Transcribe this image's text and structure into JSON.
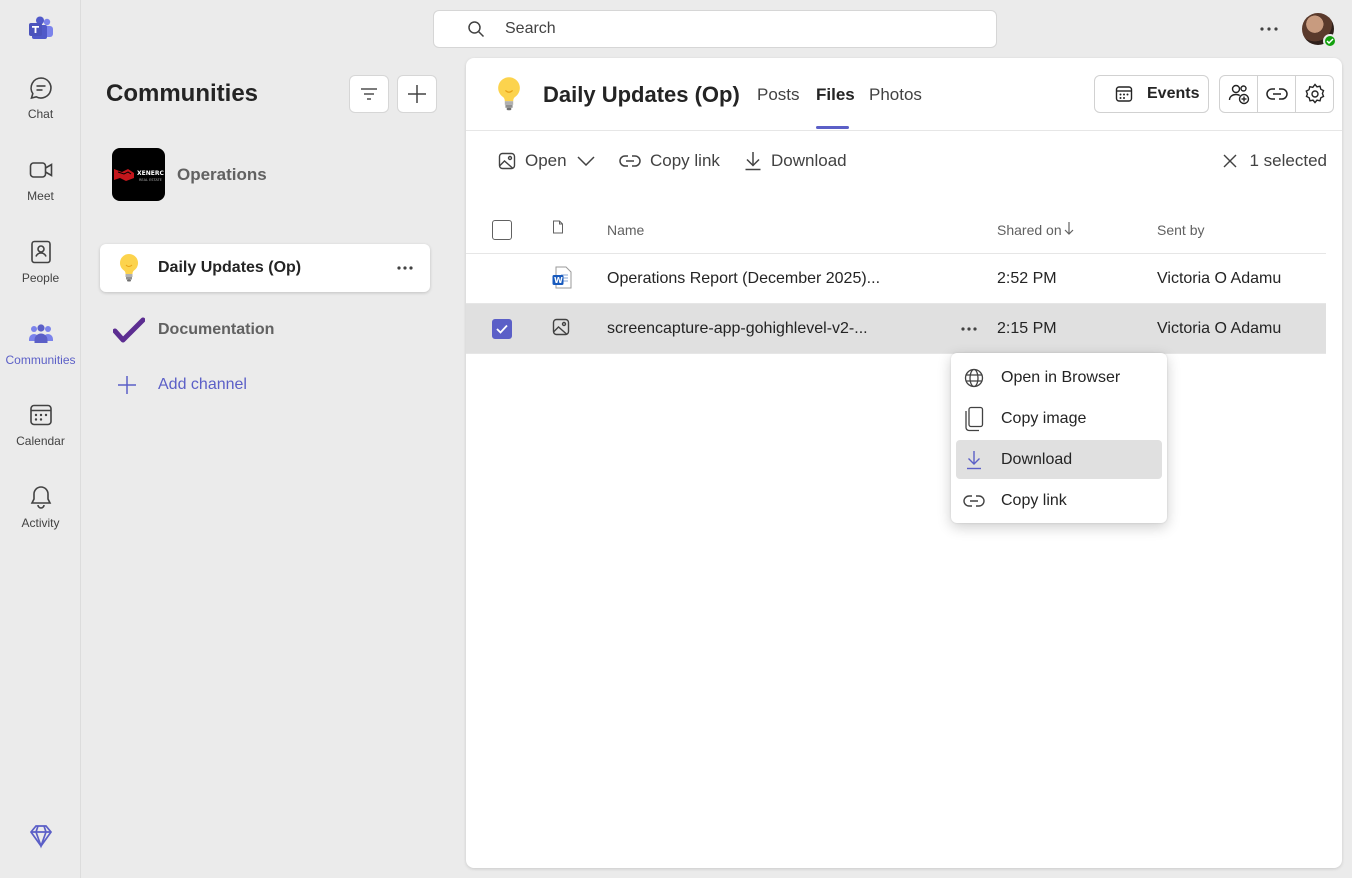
{
  "rail": {
    "items": [
      {
        "label": "Chat",
        "icon": "chat-icon"
      },
      {
        "label": "Meet",
        "icon": "video-icon"
      },
      {
        "label": "People",
        "icon": "people-book-icon"
      },
      {
        "label": "Communities",
        "icon": "communities-icon"
      },
      {
        "label": "Calendar",
        "icon": "calendar-icon"
      },
      {
        "label": "Activity",
        "icon": "bell-icon"
      }
    ],
    "active": "Communities"
  },
  "search": {
    "placeholder": "Search"
  },
  "communities": {
    "title": "Communities",
    "community_name": "Operations",
    "channels": [
      {
        "label": "Daily Updates (Op)",
        "icon": "lightbulb-icon",
        "selected": true
      },
      {
        "label": "Documentation",
        "icon": "checkmark-icon",
        "selected": false
      }
    ],
    "add_channel": "Add channel"
  },
  "header": {
    "title": "Daily Updates (Op)",
    "tabs": [
      {
        "label": "Posts"
      },
      {
        "label": "Files",
        "active": true
      },
      {
        "label": "Photos"
      }
    ],
    "events_label": "Events"
  },
  "toolbar": {
    "open_label": "Open",
    "copy_link_label": "Copy link",
    "download_label": "Download",
    "selected_label": "1 selected"
  },
  "table": {
    "columns": {
      "name": "Name",
      "shared_on": "Shared on",
      "sent_by": "Sent by"
    },
    "rows": [
      {
        "name": "Operations Report (December 2025)...",
        "shared_on": "2:52 PM",
        "sent_by": "Victoria O Adamu",
        "type": "word-doc-icon",
        "selected": false
      },
      {
        "name": "screencapture-app-gohighlevel-v2-...",
        "shared_on": "2:15 PM",
        "sent_by": "Victoria O Adamu",
        "type": "image-file-icon",
        "selected": true
      }
    ]
  },
  "context_menu": {
    "items": [
      {
        "label": "Open in Browser",
        "icon": "globe-icon"
      },
      {
        "label": "Copy image",
        "icon": "copy-icon"
      },
      {
        "label": "Download",
        "icon": "download-icon",
        "hover": true
      },
      {
        "label": "Copy link",
        "icon": "link-icon"
      }
    ]
  },
  "colors": {
    "accent": "#5b5fc7",
    "presence": "#13a10e",
    "word": "#185abd"
  }
}
